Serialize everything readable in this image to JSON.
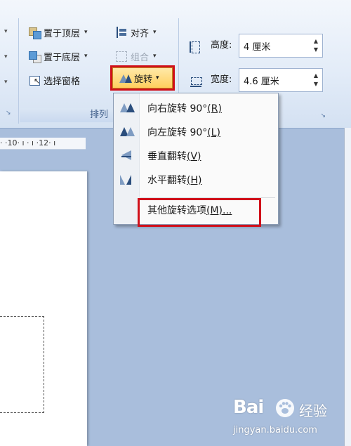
{
  "ribbon": {
    "arrange": {
      "bring_front": "置于顶层",
      "send_back": "置于底层",
      "selection_pane": "选择窗格",
      "align": "对齐",
      "group": "组合",
      "rotate": "旋转",
      "label": "排列"
    },
    "size": {
      "height_label": "高度:",
      "height_value": "4 厘米",
      "width_label": "宽度:",
      "width_value": "4.6 厘米"
    }
  },
  "ruler": {
    "text": "· ·10· ı · ı ·12· ı"
  },
  "rotate_menu": {
    "items": [
      {
        "label": "向右旋转 90°",
        "key": "(R)",
        "icon": "rotate-right-icon"
      },
      {
        "label": "向左旋转 90°",
        "key": "(L)",
        "icon": "rotate-left-icon"
      },
      {
        "label": "垂直翻转",
        "key": "(V)",
        "icon": "flip-vertical-icon"
      },
      {
        "label": "水平翻转",
        "key": "(H)",
        "icon": "flip-horizontal-icon"
      }
    ],
    "more": {
      "label": "其他旋转选项",
      "key": "(M)..."
    }
  },
  "watermark": {
    "logo": "Bai",
    "name": "经验",
    "url": "jingyan.baidu.com"
  },
  "colors": {
    "highlight": "#d0101a",
    "rotate_active": "#ffcf5e"
  }
}
